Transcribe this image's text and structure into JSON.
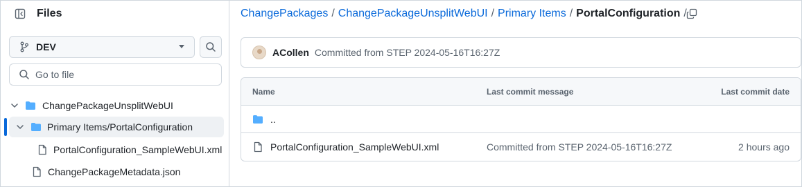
{
  "sidebar": {
    "title": "Files",
    "branch": "DEV",
    "goto_placeholder": "Go to file",
    "tree": [
      {
        "label": "ChangePackageUnsplitWebUI",
        "kind": "folder"
      },
      {
        "label": "Primary Items/PortalConfiguration",
        "kind": "folder",
        "selected": true
      },
      {
        "label": "PortalConfiguration_SampleWebUI.xml",
        "kind": "file"
      },
      {
        "label": "ChangePackageMetadata.json",
        "kind": "file"
      }
    ]
  },
  "breadcrumb": {
    "parts": [
      "ChangePackages",
      "ChangePackageUnsplitWebUI",
      "Primary Items"
    ],
    "separator": "/",
    "current": "PortalConfiguration",
    "trailing": "/"
  },
  "commit": {
    "author": "ACollen",
    "message": "Committed from STEP 2024-05-16T16:27Z"
  },
  "table": {
    "headers": {
      "name": "Name",
      "message": "Last commit message",
      "date": "Last commit date"
    },
    "parent": "..",
    "rows": [
      {
        "name": "PortalConfiguration_SampleWebUI.xml",
        "message": "Committed from STEP 2024-05-16T16:27Z",
        "date": "2 hours ago"
      }
    ]
  },
  "colors": {
    "accent": "#0969da",
    "folder": "#54aeff",
    "muted": "#59636e",
    "border": "#d0d7de"
  },
  "icons": [
    "sidebar-collapse-icon",
    "git-branch-icon",
    "caret-down-icon",
    "search-icon",
    "chevron-down-icon",
    "folder-icon",
    "file-icon",
    "copy-icon"
  ]
}
